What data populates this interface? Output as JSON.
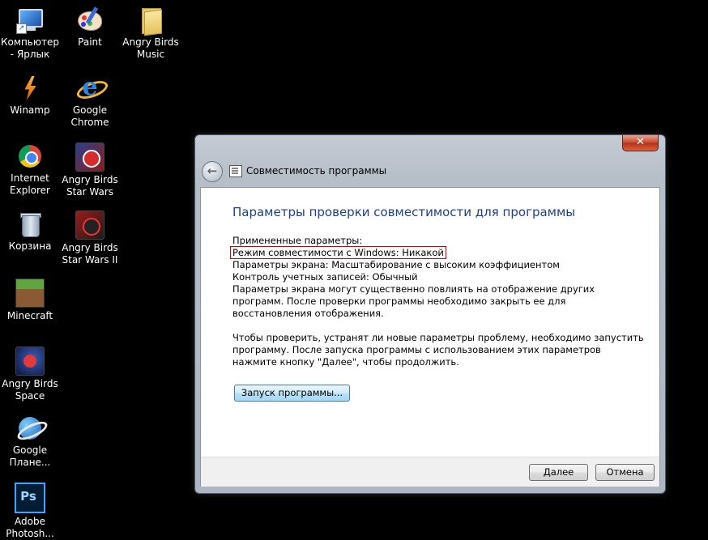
{
  "desktop": {
    "icons": [
      {
        "label": "Компьютер - Ярлык",
        "icon": "computer-shortcut-icon"
      },
      {
        "label": "Paint",
        "icon": "paint-icon"
      },
      {
        "label": "Angry Birds Music",
        "icon": "folder-icon"
      },
      {
        "label": "Winamp",
        "icon": "winamp-icon"
      },
      {
        "label": "Google Chrome",
        "icon": "internet-explorer-icon"
      },
      {
        "label": "Internet Explorer",
        "icon": "chrome-icon"
      },
      {
        "label": "Angry Birds Star Wars",
        "icon": "angry-birds-star-wars-icon"
      },
      {
        "label": "Корзина",
        "icon": "recycle-bin-icon"
      },
      {
        "label": "Angry Birds Star Wars II",
        "icon": "angry-birds-star-wars-2-icon"
      },
      {
        "label": "Minecraft",
        "icon": "minecraft-icon"
      },
      {
        "label": "Angry Birds Space",
        "icon": "angry-birds-space-icon"
      },
      {
        "label": "Google Плане...",
        "icon": "google-earth-icon"
      },
      {
        "label": "Adobe Photosh...",
        "icon": "photoshop-icon"
      }
    ]
  },
  "dialog": {
    "title": "Совместимость программы",
    "close_label": "✕",
    "back_label": "←",
    "heading": "Параметры проверки совместимости для программы",
    "applied_label": "Примененные параметры:",
    "compat_mode": "Режим совместимости с Windows: Никакой",
    "screen_params": "Параметры экрана:  Масштабирование с высоким коэффициентом",
    "uac": "Контроль учетных записей:  Обычный",
    "screen_note": "Параметры экрана могут существенно повлиять на отображение других программ. После проверки программы необходимо закрыть ее для восстановления отображения.",
    "instructions": "Чтобы проверить, устранят ли новые параметры проблему, необходимо запустить программу. После запуска программы с использованием этих параметров нажмите кнопку \"Далее\", чтобы продолжить.",
    "run_button": "Запуск программы...",
    "next_button": "Далее",
    "cancel_button": "Отмена"
  }
}
